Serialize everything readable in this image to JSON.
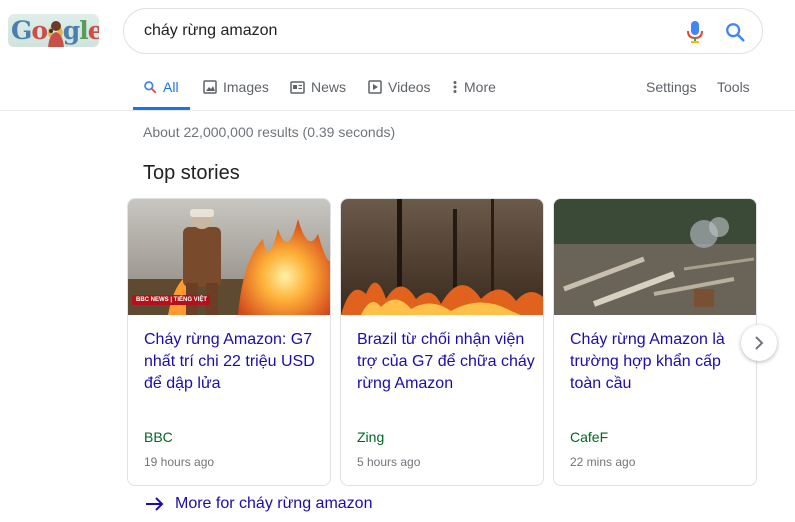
{
  "logo": {
    "alt": "Google Doodle",
    "letters": [
      "G",
      "o",
      "o",
      "g",
      "l",
      "e"
    ]
  },
  "search": {
    "query": "cháy rừng amazon"
  },
  "tabs": [
    {
      "label": "All",
      "icon": "search-icon"
    },
    {
      "label": "Images",
      "icon": "image-icon"
    },
    {
      "label": "News",
      "icon": "news-icon"
    },
    {
      "label": "Videos",
      "icon": "video-icon"
    },
    {
      "label": "More",
      "icon": "more-vert-icon"
    }
  ],
  "tools": {
    "settings": "Settings",
    "tools": "Tools"
  },
  "results_stats": "About 22,000,000 results (0.39 seconds)",
  "top_stories": {
    "heading": "Top stories",
    "cards": [
      {
        "title": "Cháy rừng Amazon: G7 nhất trí chi 22 triệu USD để dập lửa",
        "source": "BBC",
        "time": "19 hours ago",
        "badge": "BBC NEWS | TIẾNG VIỆT"
      },
      {
        "title": "Brazil từ chối nhận viện trợ của G7 để chữa cháy rừng Amazon",
        "source": "Zing",
        "time": "5 hours ago"
      },
      {
        "title": "Cháy rừng Amazon là trường hợp khẩn cấp toàn cầu",
        "source": "CafeF",
        "time": "22 mins ago"
      }
    ],
    "more_link": "More for cháy rừng amazon"
  },
  "colors": {
    "link": "#1a0dab",
    "accent": "#1a73e8",
    "source": "#006621"
  }
}
